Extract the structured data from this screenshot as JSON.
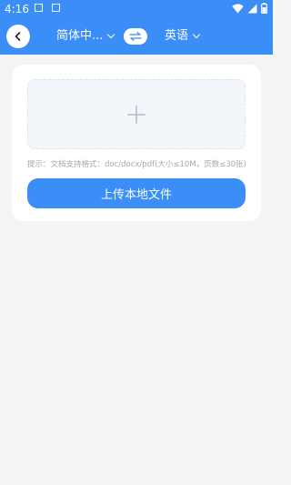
{
  "status": {
    "time": "4:16"
  },
  "header": {
    "source_lang": "简体中...",
    "target_lang": "英语"
  },
  "upload": {
    "hint": "提示：文档支持格式：doc/docx/pdf(大小≤10M，页数≤30张)",
    "button_label": "上传本地文件"
  },
  "icons": {
    "back": "chevron-left-icon",
    "swap": "swap-arrows-icon",
    "add": "plus-icon",
    "wifi": "wifi-icon",
    "signal": "signal-icon",
    "battery": "battery-icon"
  },
  "colors": {
    "accent": "#3b8ef7",
    "background": "#f4f4f4"
  }
}
